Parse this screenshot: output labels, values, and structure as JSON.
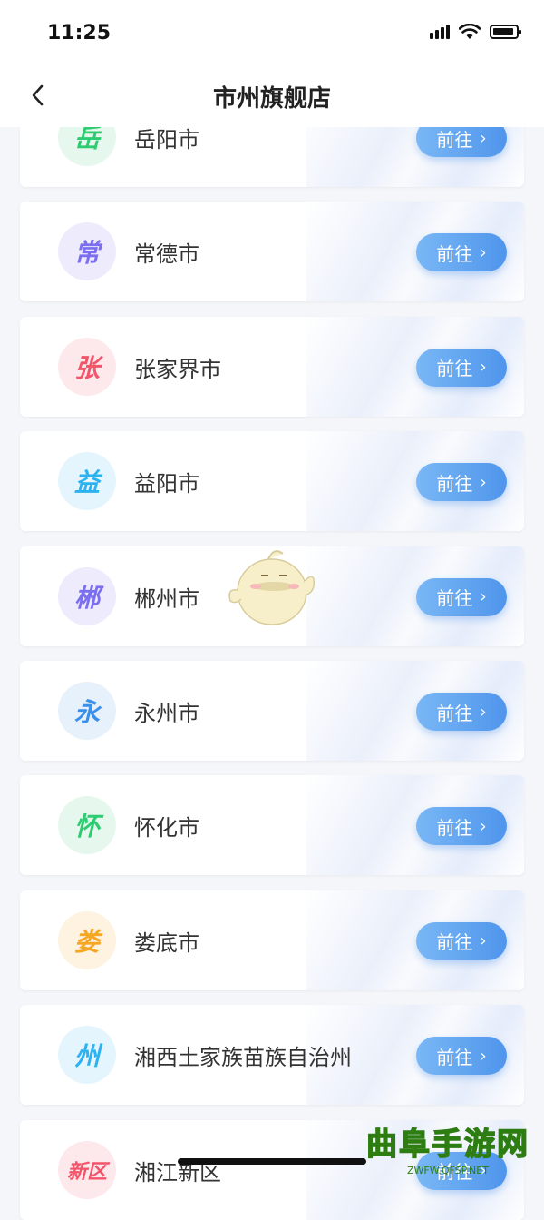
{
  "status_bar": {
    "time": "11:25"
  },
  "nav": {
    "title": "市州旗舰店"
  },
  "go_label": "前往",
  "cities": [
    {
      "badge": "岳",
      "name": "岳阳市",
      "color": "#2ecc71",
      "bg": "#e6f8ee"
    },
    {
      "badge": "常",
      "name": "常德市",
      "color": "#7b6ff0",
      "bg": "#eeebfd"
    },
    {
      "badge": "张",
      "name": "张家界市",
      "color": "#f2556a",
      "bg": "#fde9ec"
    },
    {
      "badge": "益",
      "name": "益阳市",
      "color": "#2bb2f0",
      "bg": "#e5f5fd"
    },
    {
      "badge": "郴",
      "name": "郴州市",
      "color": "#7b6ff0",
      "bg": "#eeebfd"
    },
    {
      "badge": "永",
      "name": "永州市",
      "color": "#3a8fe8",
      "bg": "#e6f1fc"
    },
    {
      "badge": "怀",
      "name": "怀化市",
      "color": "#2ecc71",
      "bg": "#e6f8ee"
    },
    {
      "badge": "娄",
      "name": "娄底市",
      "color": "#f5a623",
      "bg": "#fef2e0"
    },
    {
      "badge": "州",
      "name": "湘西土家族苗族自治州",
      "color": "#2bb2f0",
      "bg": "#e5f5fd"
    },
    {
      "badge": "新区",
      "name": "湘江新区",
      "color": "#f2556a",
      "bg": "#fde9ec"
    }
  ],
  "watermark": {
    "main": "曲阜手游网",
    "sub": "ZWFW.QFSP.NET"
  }
}
